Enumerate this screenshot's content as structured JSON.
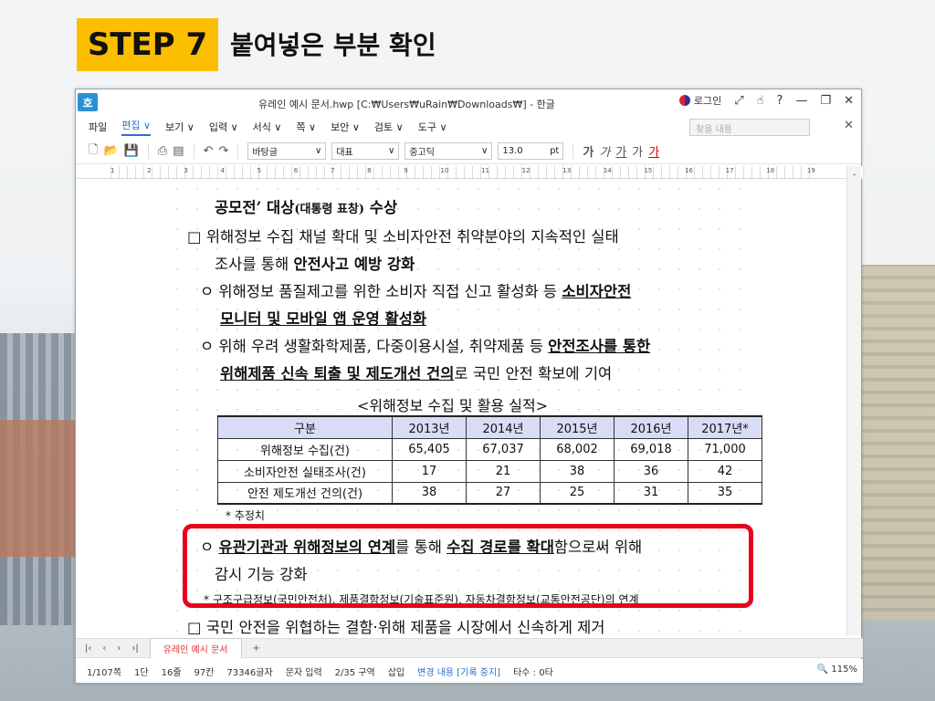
{
  "step": {
    "badge": "STEP 7",
    "title": "붙여넣은 부분 확인"
  },
  "window": {
    "title": "유레인 예시 문서.hwp [C:₩Users₩uRain₩Downloads₩] - 한글",
    "login": "로그인",
    "app_icon": "호"
  },
  "menu": {
    "items": [
      "파일",
      "편집 ∨",
      "보기 ∨",
      "입력 ∨",
      "서식 ∨",
      "쪽 ∨",
      "보안 ∨",
      "검토 ∨",
      "도구 ∨"
    ],
    "find_placeholder": "찾을 내용"
  },
  "toolbar": {
    "style": "바탕글",
    "lang": "대표",
    "font": "중고딕",
    "size": "13.0",
    "unit": "pt",
    "fmt": [
      "가",
      "가",
      "가",
      "가",
      "가"
    ]
  },
  "ruler": {
    "nums": [
      "1",
      "2",
      "3",
      "4",
      "5",
      "6",
      "7",
      "8",
      "9",
      "10",
      "11",
      "12",
      "13",
      "14",
      "15",
      "16",
      "17",
      "18",
      "19"
    ]
  },
  "document": {
    "l1a": "공모전’ 대상",
    "l1b": "(대통령 표창)",
    "l1c": " 수상",
    "l2": "□ 위해정보 수집 채널 확대 및 소비자안전 취약분야의 지속적인 실태",
    "l3a": "조사를 통해 ",
    "l3b": "안전사고 예방 강화",
    "l4a": "ㅇ 위해정보 품질제고를 위한 소비자 직접 신고 활성화 등 ",
    "l4b": "소비자안전",
    "l5": "모니터 및 모바일 앱 운영 활성화",
    "l6a": "ㅇ 위해 우려 생활화학제품, 다중이용시설, 취약제품 등 ",
    "l6b": "안전조사를 통한",
    "l7a": "위해제품 신속 퇴출 및 제도개선 건의",
    "l7b": "로 국민 안전 확보에 기여",
    "table_caption": "<위해정보 수집 및 활용 실적>",
    "table": {
      "headers": [
        "구분",
        "2013년",
        "2014년",
        "2015년",
        "2016년",
        "2017년*"
      ],
      "rows": [
        [
          "위해정보 수집(건)",
          "65,405",
          "67,037",
          "68,002",
          "69,018",
          "71,000"
        ],
        [
          "소비자안전 실태조사(건)",
          "17",
          "21",
          "38",
          "36",
          "42"
        ],
        [
          "안전 제도개선 건의(건)",
          "38",
          "27",
          "25",
          "31",
          "35"
        ]
      ]
    },
    "footnote": "* 추정치",
    "l8a": "ㅇ ",
    "l8b": "유관기관과 위해정보의 연계",
    "l8c": "를 통해 ",
    "l8d": "수집 경로를 확대",
    "l8e": "함으로써 위해",
    "l9": "감시 기능 강화",
    "l10": "* 구조구급정보(국민안전처), 제품결함정보(기술표준원), 자동차결함정보(교통안전공단)의 연계",
    "l11": "□ 국민 안전을 위협하는 결함·위해 제품을 시장에서 신속하게 제거"
  },
  "tabs": {
    "doc_tab": "유레인 예시 문서",
    "add": "+"
  },
  "status": {
    "page": "1/107쪽",
    "col": "1단",
    "line": "16줄",
    "chars": "97칸",
    "count": "73346글자",
    "mode": "문자 입력",
    "section": "2/35 구역",
    "insert": "삽입",
    "change": "변경 내용 [기록 중지]",
    "typing": "타수 : 0타",
    "zoom": "115%"
  }
}
